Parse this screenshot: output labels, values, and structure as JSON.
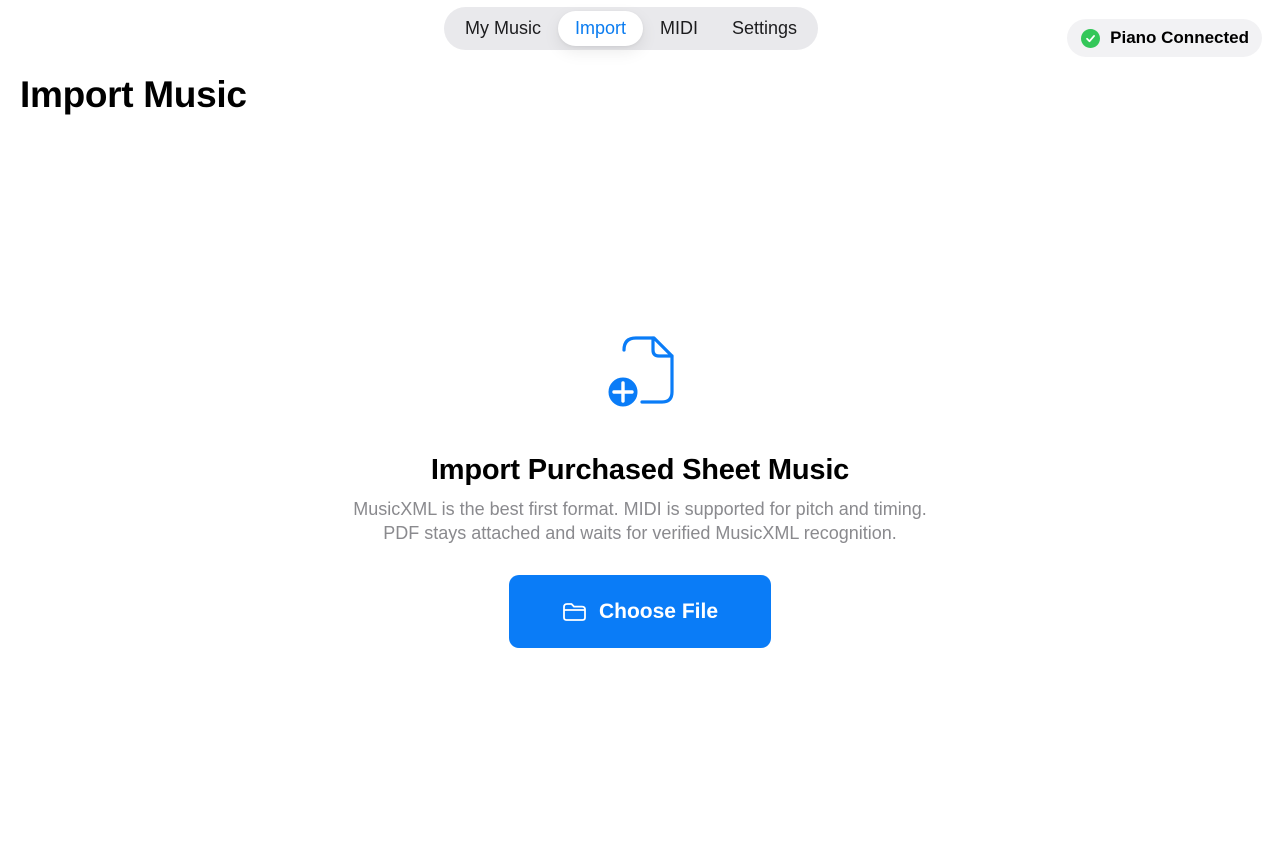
{
  "nav": {
    "tabs": [
      {
        "label": "My Music",
        "active": false
      },
      {
        "label": "Import",
        "active": true
      },
      {
        "label": "MIDI",
        "active": false
      },
      {
        "label": "Settings",
        "active": false
      }
    ]
  },
  "status": {
    "label": "Piano Connected",
    "icon": "checkmark-circle-icon",
    "color": "#34c759"
  },
  "page": {
    "title": "Import Music"
  },
  "empty_state": {
    "icon": "document-add-icon",
    "title": "Import Purchased Sheet Music",
    "description_lines": [
      "MusicXML is the best first format. MIDI is supported for pitch and timing.",
      "PDF stays attached and waits for verified MusicXML recognition."
    ],
    "button_label": "Choose File",
    "button_icon": "folder-icon"
  },
  "colors": {
    "accent": "#0a7cf7",
    "active_tab_text": "#0a7cf0",
    "connected": "#34c759"
  }
}
